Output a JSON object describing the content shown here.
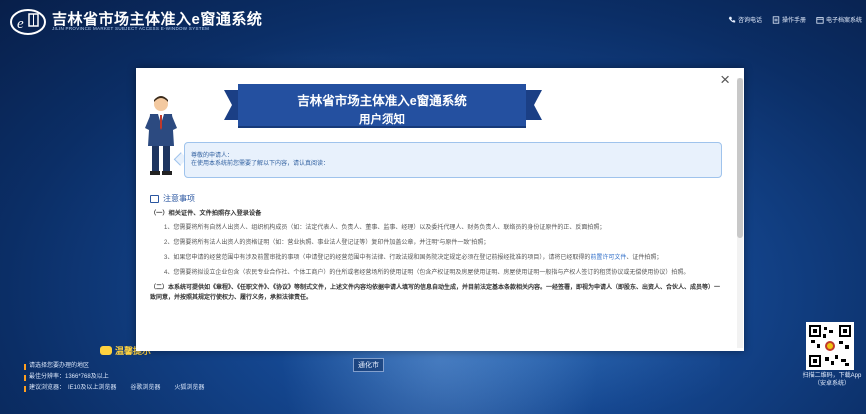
{
  "app": {
    "title": "吉林省市场主体准入e窗通系统",
    "subtitle": "JILIN PROVINCE MARKET SUBJECT ACCESS E-WINDOW SYSTEM"
  },
  "top_links": [
    {
      "label": "咨询电话",
      "icon": "phone-icon"
    },
    {
      "label": "操作手册",
      "icon": "manual-icon"
    },
    {
      "label": "电子档案系统",
      "icon": "archive-icon"
    }
  ],
  "tips": {
    "title": "温馨提示",
    "items": [
      "请选择您要办理的地区",
      "最佳分辨率：1366*768及以上"
    ],
    "browser_label": "建议浏览器：",
    "browsers": [
      "IE10及以上浏览器",
      "谷歌浏览器",
      "火狐浏览器"
    ]
  },
  "map": {
    "city_label": "通化市"
  },
  "qr": {
    "caption": "扫描二维码，下载App（安卓系统）"
  },
  "modal": {
    "close_label": "×",
    "ribbon_title": "吉林省市场主体准入e窗通系统",
    "ribbon_subtitle": "用户须知",
    "notice_greeting": "尊敬的申请人：",
    "notice_text": "在使用本系统前您需要了解以下内容，请认真阅读：",
    "section_title": "注意事项",
    "sub_head_1": "（一）相关证件、文件拍照存入登录设备",
    "para_1": "1、您需要将所有自然人出资人、组织机构成员（如：法定代表人、负责人、董事、监事、经理）以及委托代理人、财务负责人、联络员的身份证原件的正、反面拍照；",
    "para_2": "2、您需要将所有法人出资人的资格证明（如：营业执照、事业法人登记证等）复印件加盖公章，并注明“与原件一致”拍照；",
    "para_3_a": "3、如果您申请的经营范围中有涉及前置审批的事项（申请登记的经营范围中有法律、行政法规和国务院决定规定必须在登记前报经批准的项目），请将已经取得的",
    "para_3_link": "前置许可文件",
    "para_3_b": "、证件拍照；",
    "para_4": "4、您需要将拟设立企业包含（农民专业合作社、个体工商户）的住所或者经营场所的使用证明（包含产权证明及房屋使用证明、房屋使用证明一般指与产权人签订的租赁协议或无偿使用协议）拍照。",
    "para_5": "（二）本系统可提供如《章程》、《任职文件》、《协议》等制式文件，上述文件内容均依据申请人填写的信息自动生成，并目前法定基本条款相关内容。一经签署，即视为申请人（即股东、出资人、合伙人、成员等）一致同意，并按照其规定行使权力、履行义务，承担法律责任。"
  }
}
